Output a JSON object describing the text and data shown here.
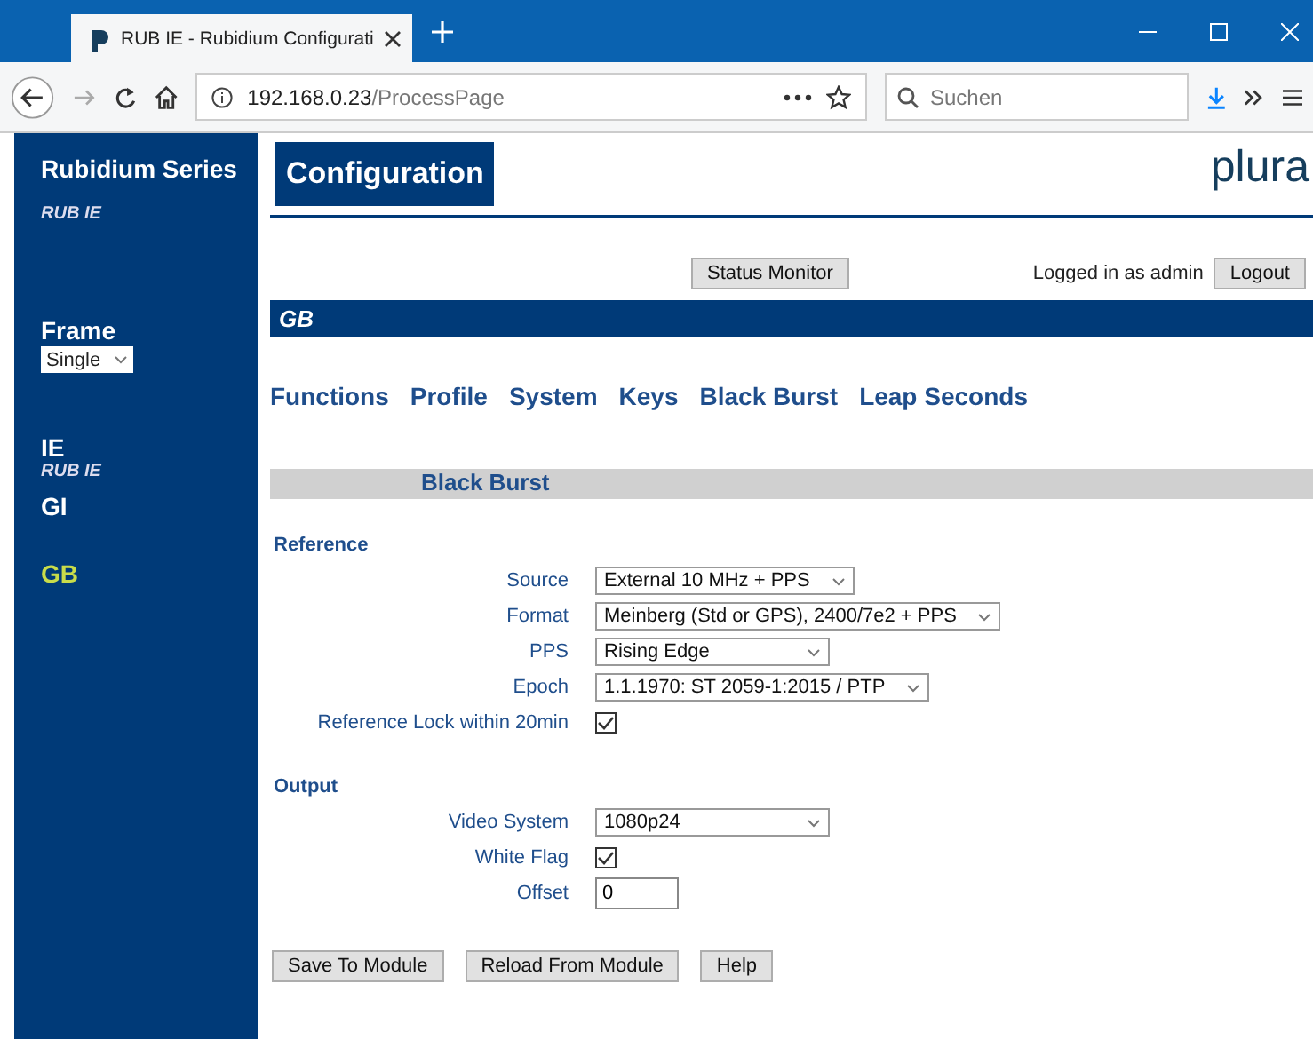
{
  "browser": {
    "tab_title": "RUB IE - Rubidium Configurati",
    "address_host": "192.168.0.23",
    "address_path": "/ProcessPage",
    "search_placeholder": "Suchen"
  },
  "sidebar": {
    "title": "Rubidium Series",
    "subtitle": "RUB IE",
    "frame_label": "Frame",
    "frame_value": "Single",
    "items": [
      {
        "label": "IE",
        "sub": "RUB IE",
        "selected": false
      },
      {
        "label": "GI",
        "selected": false
      },
      {
        "label": "GB",
        "selected": true
      }
    ]
  },
  "header": {
    "title": "Configuration",
    "logo": "plura"
  },
  "status_monitor": "Status Monitor",
  "login_text": "Logged in as admin",
  "logout": "Logout",
  "module_bar": "GB",
  "nav": [
    "Functions",
    "Profile",
    "System",
    "Keys",
    "Black Burst",
    "Leap Seconds"
  ],
  "section_title": "Black Burst",
  "groups": [
    {
      "title": "Reference",
      "rows": [
        {
          "kind": "select",
          "label": "Source",
          "value": "External 10 MHz + PPS"
        },
        {
          "kind": "select",
          "label": "Format",
          "value": "Meinberg (Std or GPS), 2400/7e2 + PPS"
        },
        {
          "kind": "select",
          "label": "PPS",
          "value": "Rising Edge"
        },
        {
          "kind": "select",
          "label": "Epoch",
          "value": "1.1.1970: ST 2059-1:2015 / PTP"
        },
        {
          "kind": "checkbox",
          "label": "Reference Lock within 20min",
          "checked": true
        }
      ]
    },
    {
      "title": "Output",
      "rows": [
        {
          "kind": "select",
          "label": "Video System",
          "value": "1080p24"
        },
        {
          "kind": "checkbox",
          "label": "White Flag",
          "checked": true
        },
        {
          "kind": "input",
          "label": "Offset",
          "value": "0"
        }
      ]
    }
  ],
  "buttons": [
    "Save To Module",
    "Reload From Module",
    "Help"
  ]
}
